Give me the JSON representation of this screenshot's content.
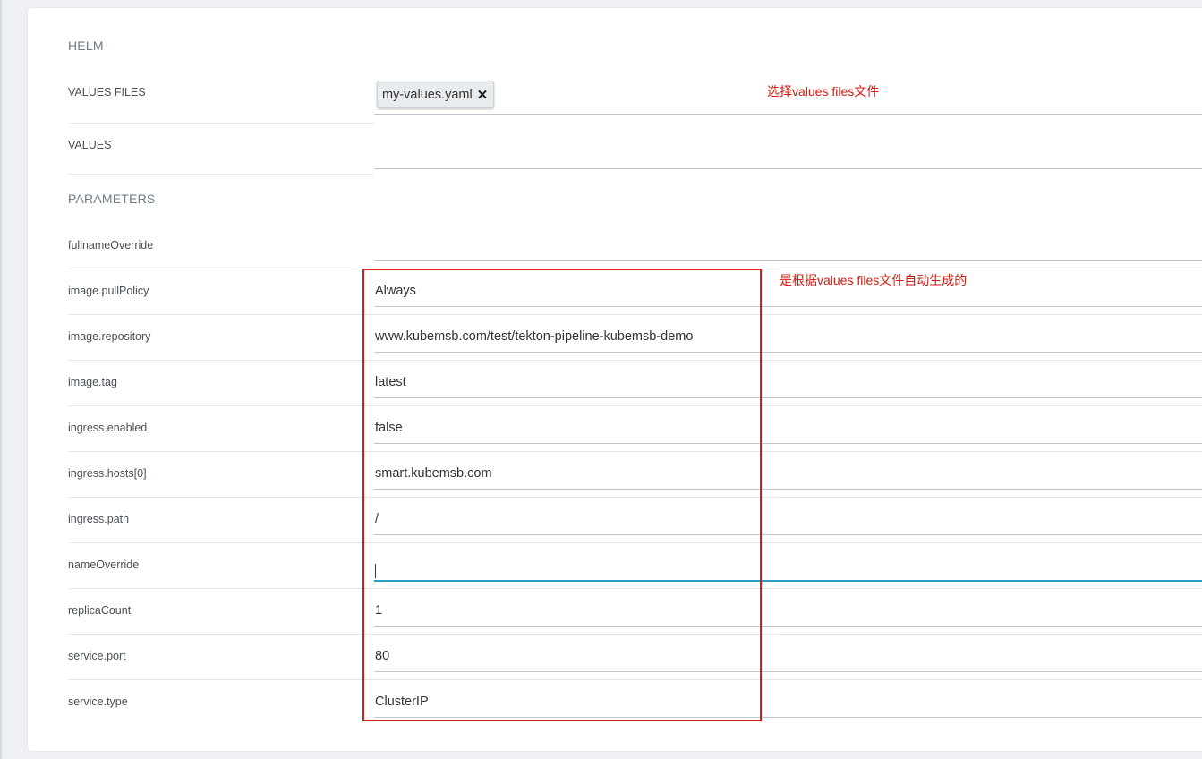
{
  "helm": {
    "section_title": "HELM",
    "values_files": {
      "label": "VALUES FILES",
      "chip": "my-values.yaml",
      "remove_icon": "close-icon"
    },
    "values": {
      "label": "VALUES",
      "value": ""
    }
  },
  "parameters": {
    "section_title": "PARAMETERS",
    "rows": [
      {
        "label": "fullnameOverride",
        "value": ""
      },
      {
        "label": "image.pullPolicy",
        "value": "Always"
      },
      {
        "label": "image.repository",
        "value": "www.kubemsb.com/test/tekton-pipeline-kubemsb-demo"
      },
      {
        "label": "image.tag",
        "value": "latest"
      },
      {
        "label": "ingress.enabled",
        "value": "false"
      },
      {
        "label": "ingress.hosts[0]",
        "value": "smart.kubemsb.com"
      },
      {
        "label": "ingress.path",
        "value": "/"
      },
      {
        "label": "nameOverride",
        "value": ""
      },
      {
        "label": "replicaCount",
        "value": "1"
      },
      {
        "label": "service.port",
        "value": "80"
      },
      {
        "label": "service.type",
        "value": "ClusterIP"
      }
    ]
  },
  "annotations": {
    "values_files_note": "选择values files文件",
    "params_note": "是根据values files文件自动生成的"
  },
  "colors": {
    "annotation_red": "#e0191c",
    "active_field": "#2aa0c0"
  }
}
